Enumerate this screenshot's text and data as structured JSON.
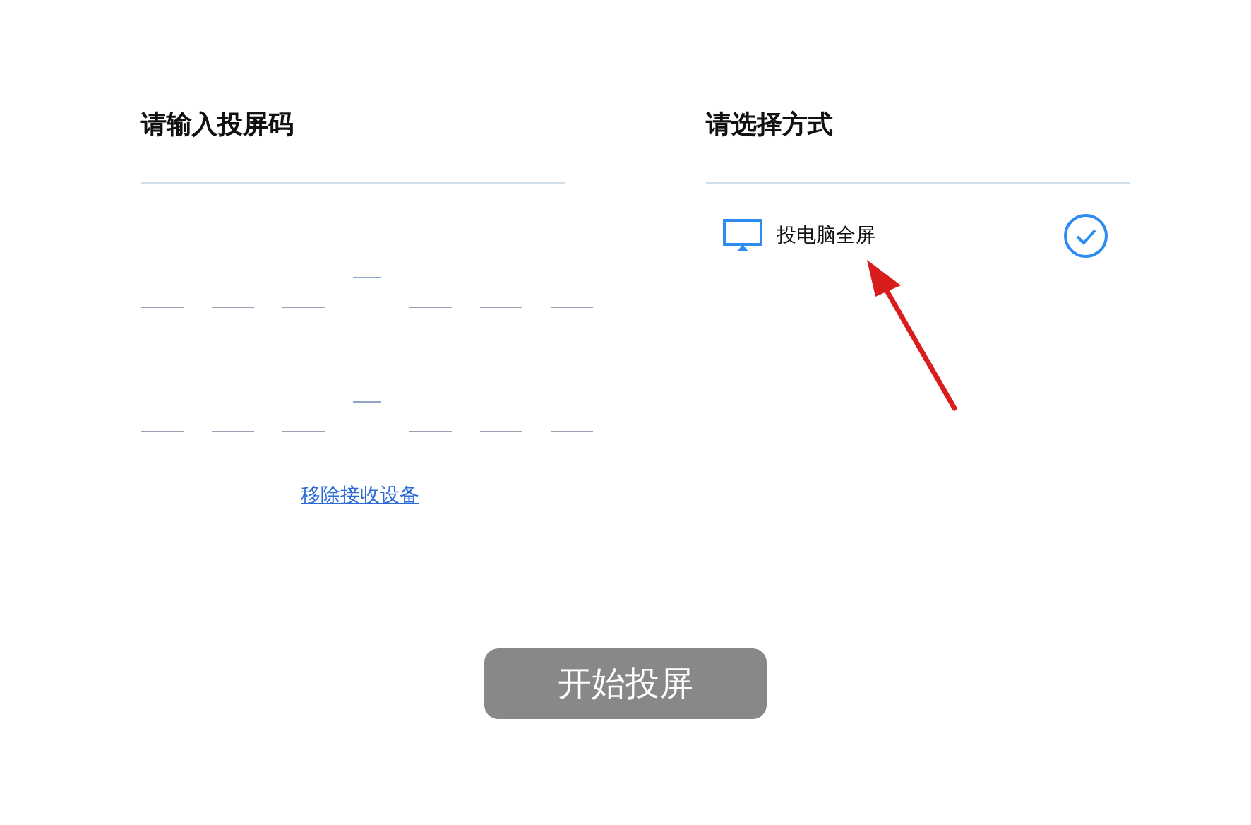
{
  "code_panel": {
    "title": "请输入投屏码",
    "code_rows": [
      {
        "kind": "code"
      },
      {
        "kind": "code"
      }
    ],
    "remove_link": "移除接收设备"
  },
  "mode_panel": {
    "title": "请选择方式",
    "options": [
      {
        "label": "投电脑全屏",
        "selected": true
      }
    ]
  },
  "start_button": "开始投屏"
}
